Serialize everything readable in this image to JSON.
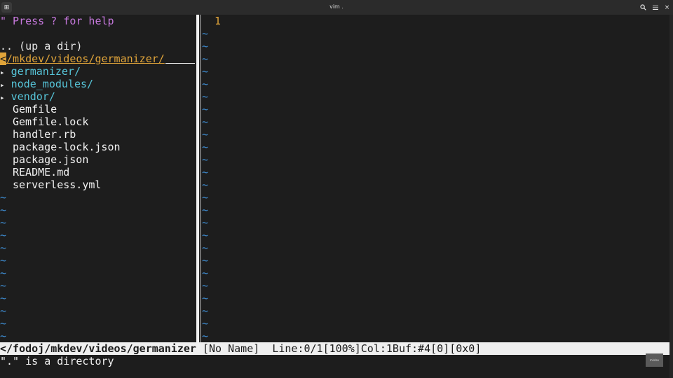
{
  "window": {
    "title": "vim .",
    "left_icon": "terminal-tab-icon",
    "right_icons": [
      "search-icon",
      "menu-icon",
      "close-icon"
    ]
  },
  "netrw": {
    "help": "\" Press ? for help",
    "up_dir": ".. (up a dir)",
    "cursor_char": "<",
    "current_dir": "/mkdev/videos/germanizer/",
    "dirs": [
      "germanizer/",
      "node_modules/",
      "vendor/"
    ],
    "dir_marker": "▸",
    "files": [
      "Gemfile",
      "Gemfile.lock",
      "handler.rb",
      "package-lock.json",
      "package.json",
      "README.md",
      "serverless.yml"
    ],
    "tilde": "~"
  },
  "editor": {
    "line_number": "1",
    "tilde": "~"
  },
  "statusline": {
    "path": "</fodoj/mkdev/videos/germanizer",
    "rest": " [No Name]  Line:0/1[100%]Col:1Buf:#4[0][0x0]"
  },
  "cmdline": "\".\" is a directory",
  "watermark": "mkdev"
}
